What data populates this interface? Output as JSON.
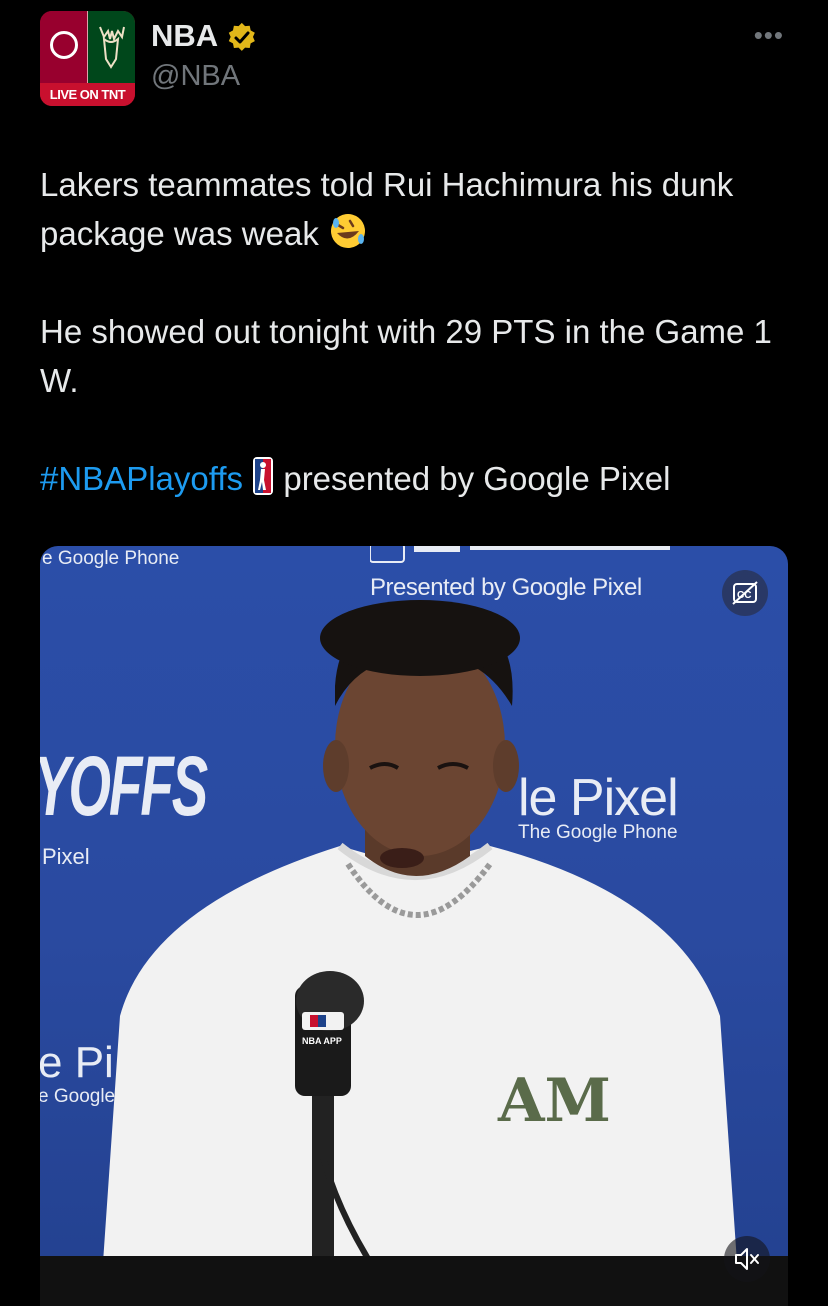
{
  "account": {
    "name": "NBA",
    "handle": "@NBA",
    "avatar_badge": "LIVE ON TNT",
    "verified_color": "#e2b719"
  },
  "menu": {
    "more_label": "•••"
  },
  "tweet": {
    "line1": "Lakers teammates told Rui Hachimura his dunk package was weak",
    "line2": "He showed out tonight with 29 PTS in the Game 1 W.",
    "hashtag": "#NBAPlayoffs",
    "presented": "presented by Google Pixel",
    "emoji": "rolling-on-floor-laughing-emoji",
    "hashtag_icon": "nba-logo-icon",
    "link_color": "#1d9bf0"
  },
  "media": {
    "backdrop": {
      "phone_top": "e Google Phone",
      "presented": "Presented by Google Pixel",
      "offs": "YOFFS",
      "pixel_left": "Pixel",
      "pixel_right": "le Pixel",
      "google_phone": "The Google Phone",
      "e_pi": "e Pi",
      "e_google": "e Google"
    },
    "mic_label": "NBA APP",
    "cc_icon": "captions-icon",
    "mute_icon": "volume-muted-icon"
  }
}
